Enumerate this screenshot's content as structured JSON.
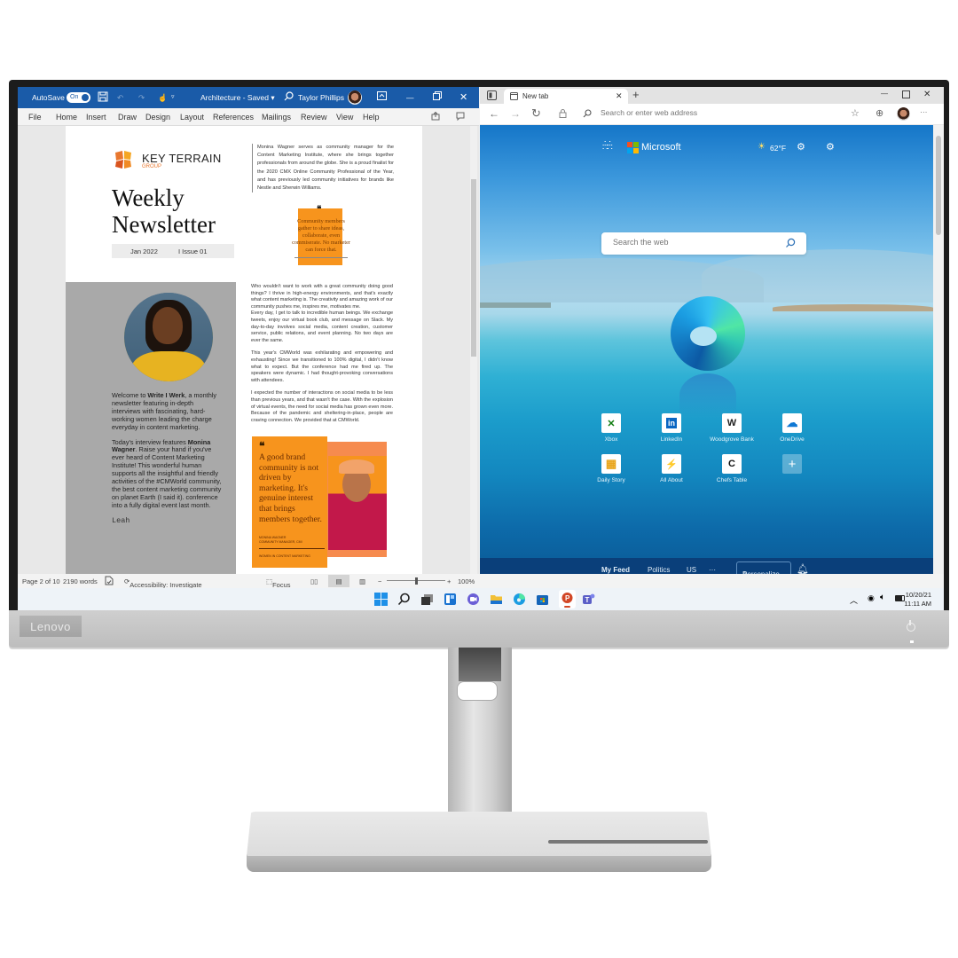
{
  "device": {
    "brand": "Lenovo"
  },
  "word": {
    "autosave_label": "AutoSave",
    "autosave_state": "On",
    "document_title": "Architecture - Saved",
    "user_name": "Taylor Phillips",
    "accent": "#1a5ba8",
    "ribbon_tabs": [
      "File",
      "Home",
      "Insert",
      "Draw",
      "Design",
      "Layout",
      "References",
      "Mailings",
      "Review",
      "View",
      "Help"
    ],
    "status": {
      "page": "Page 2 of 10",
      "words": "2190 words",
      "accessibility": "Accessibility: Investigate",
      "focus": "Focus",
      "zoom": "100%",
      "zoom_minus": "−",
      "zoom_plus": "+"
    },
    "document": {
      "company_name": "KEY TERRAIN",
      "company_sub": "GROUP",
      "title_line1": "Weekly",
      "title_line2": "Newsletter",
      "date": "Jan 2022",
      "issue": "I  Issue 01",
      "bio": "Monina Wagner serves as community manager for the Content Marketing Institute, where she brings together professionals from around the globe. She is a proud finalist for the 2020 CMX Online Community Professional of the Year, and has previously led community initiatives for brands like Nestle and Sherwin Williams.",
      "pull_quote_mark": "❝",
      "pull_quote": "Community members gather to share ideas, collaborate, even commiserate. No marketer can force that.",
      "intro_p1_pre": "Welcome to ",
      "intro_p1_bold": "Write I Werk",
      "intro_p1_post": ", a monthly newsletter featuring in-depth interviews with fascinating, hard-working women leading the charge everyday in content marketing.",
      "intro_p2_pre": "Today's interview features ",
      "intro_p2_bold": "Monina Wagner",
      "intro_p2_post": ". Raise your hand if you've ever heard of Content Marketing Institute! This wonderful human supports all the insightful and friendly activities of the #CMWorld community, the best content marketing community on planet Earth (I said it). conference into a fully digital event last month.",
      "signature": "Leah",
      "body_p1": "Who wouldn't want to work with a great community doing good things? I thrive in high-energy environments, and that's exactly what content marketing is. The creativity and amazing work of our community pushes me, inspires me, motivates me.",
      "body_p2": "Every day, I get to talk to incredible human beings. We exchange tweets, enjoy our virtual book club, and message on Slack. My day-to-day involves social media, content creation, customer service, public relations, and event planning. No two days are ever the same.",
      "body_p3": "This year's CMWorld was exhilarating and empowering and exhausting! Since we transitioned to 100% digital, I didn't know what to expect. But the conference had me fired up. The speakers were dynamic. I had thought-provoking conversations with attendees.",
      "body_p4": "I expected the number of interactions on social media to be less than previous years, and that wasn't the case. With the explosion of virtual events, the need for social media has grown even more. Because of the pandemic and sheltering-in-place, people are craving connection. We provided that at CMWorld.",
      "promo_quote_mark": "❝",
      "promo_quote": "A good brand community is not driven by marketing. It's genuine interest that brings members together.",
      "promo_attrib_name": "MONINA WAGNER",
      "promo_attrib_role": "COMMUNITY MANAGER, CMI",
      "promo_footer": "WOMEN IN CONTENT MARKETING"
    }
  },
  "edge": {
    "tab_title": "New tab",
    "address_placeholder": "Search or enter web address",
    "brand": "Microsoft",
    "weather": "62°F",
    "search_placeholder": "Search the web",
    "quick_links": [
      {
        "label": "Xbox",
        "icon": "xbox-icon",
        "glyph": "✕",
        "color": "#107c10"
      },
      {
        "label": "LinkedIn",
        "icon": "linkedin-icon",
        "glyph": "in",
        "color": "#0a66c2"
      },
      {
        "label": "Woodgrove Bank",
        "icon": "woodgrove-icon",
        "glyph": "W",
        "color": "#222222"
      },
      {
        "label": "OneDrive",
        "icon": "onedrive-icon",
        "glyph": "☁",
        "color": "#0f78d4"
      },
      {
        "label": "Daily Story",
        "icon": "daily-story-icon",
        "glyph": "▦",
        "color": "#e8a317"
      },
      {
        "label": "All About",
        "icon": "all-about-icon",
        "glyph": "⚡",
        "color": "#f7941d"
      },
      {
        "label": "Chefs Table",
        "icon": "chefs-table-icon",
        "glyph": "C",
        "color": "#111111"
      }
    ],
    "add_tile_glyph": "+",
    "feed_tabs": [
      "My Feed",
      "Politics",
      "US",
      "···"
    ],
    "personalize_label": "Personalize"
  },
  "taskbar": {
    "apps": [
      {
        "name": "start-icon",
        "color": "#1e90e8"
      },
      {
        "name": "search-icon",
        "color": "#222222"
      },
      {
        "name": "task-view-icon",
        "color": "#333333"
      },
      {
        "name": "widgets-icon",
        "color": "#1a73d0"
      },
      {
        "name": "chat-icon",
        "color": "#6b5fd6"
      },
      {
        "name": "file-explorer-icon",
        "color": "#f2c037"
      },
      {
        "name": "edge-icon",
        "color": "#1b9de2"
      },
      {
        "name": "store-icon",
        "color": "#1565b8"
      },
      {
        "name": "powerpoint-icon",
        "color": "#d24726"
      },
      {
        "name": "teams-icon",
        "color": "#5b5fc7"
      }
    ],
    "date": "10/20/21",
    "time": "11:11 AM"
  }
}
